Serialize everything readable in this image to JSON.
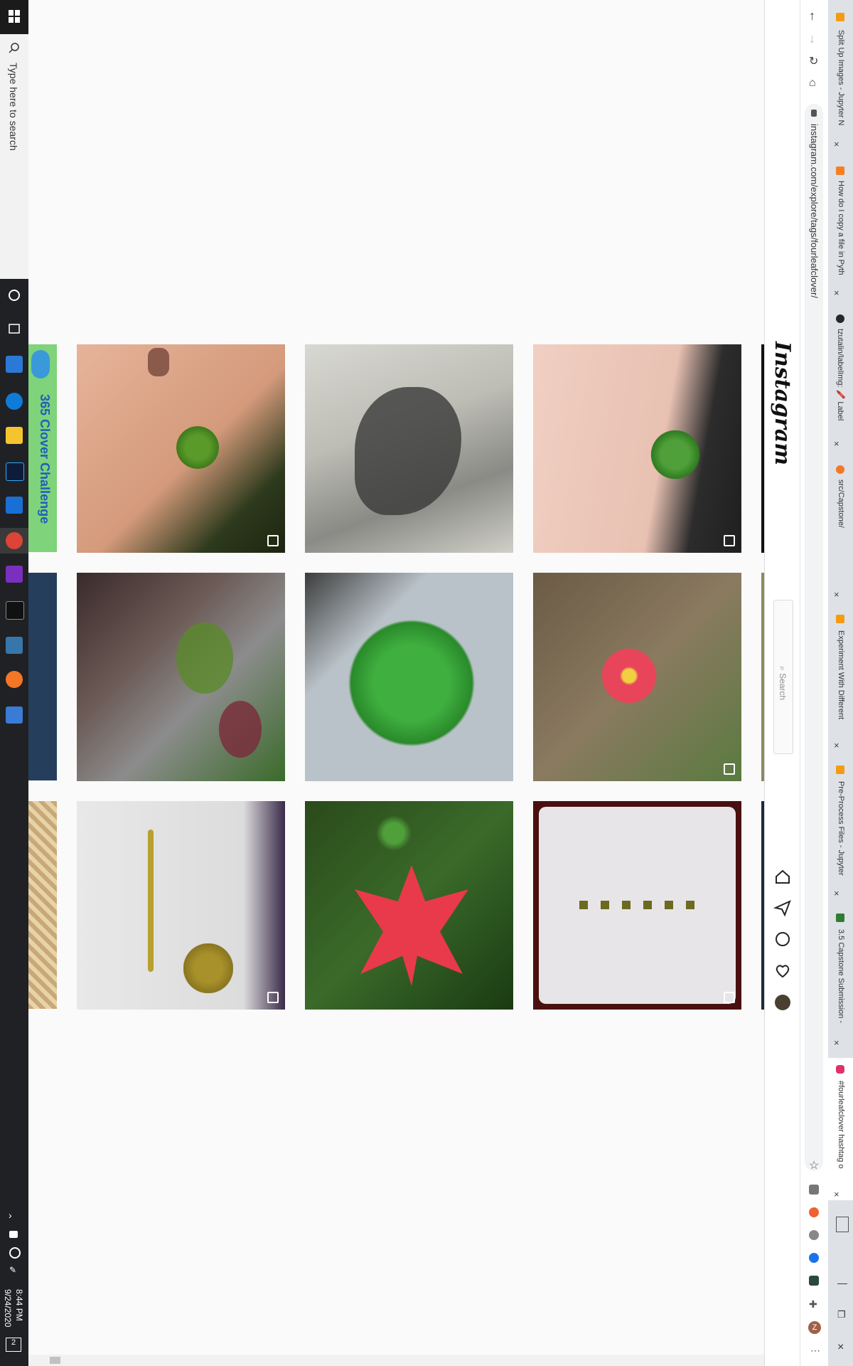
{
  "taskbar": {
    "search_placeholder": "Type here to search",
    "clock_time": "8:44 PM",
    "clock_date": "9/24/2020",
    "notification_count": "2"
  },
  "browser": {
    "address": "instagram.com/explore/tags/fourleafclover/",
    "tabs": [
      {
        "label": "Split Up Images - Jupyter N",
        "color": "#f39c12"
      },
      {
        "label": "How do I copy a file in Pyth",
        "color": "#f48024"
      },
      {
        "label": "tzutalin/labelImg: 🖍️ Label",
        "color": "#24292e"
      },
      {
        "label": "src/Capstone/",
        "color": "#f37726"
      },
      {
        "label": "Experiment With Different",
        "color": "#f39c12"
      },
      {
        "label": "Pre-Process Files - Jupyter",
        "color": "#f39c12"
      },
      {
        "label": "3.5 Capstone Submission -",
        "color": "#2e7d32"
      },
      {
        "label": "#fourleafclover hashtag o",
        "color": "#e1306c"
      }
    ]
  },
  "instagram": {
    "logo": "Instagram",
    "search_placeholder": "Search",
    "left_column_caption": "365 Clover Challenge"
  },
  "colors": {
    "taskbar_bg": "#202124",
    "chrome_bg": "#ffffff",
    "ig_bg": "#fafafa"
  }
}
